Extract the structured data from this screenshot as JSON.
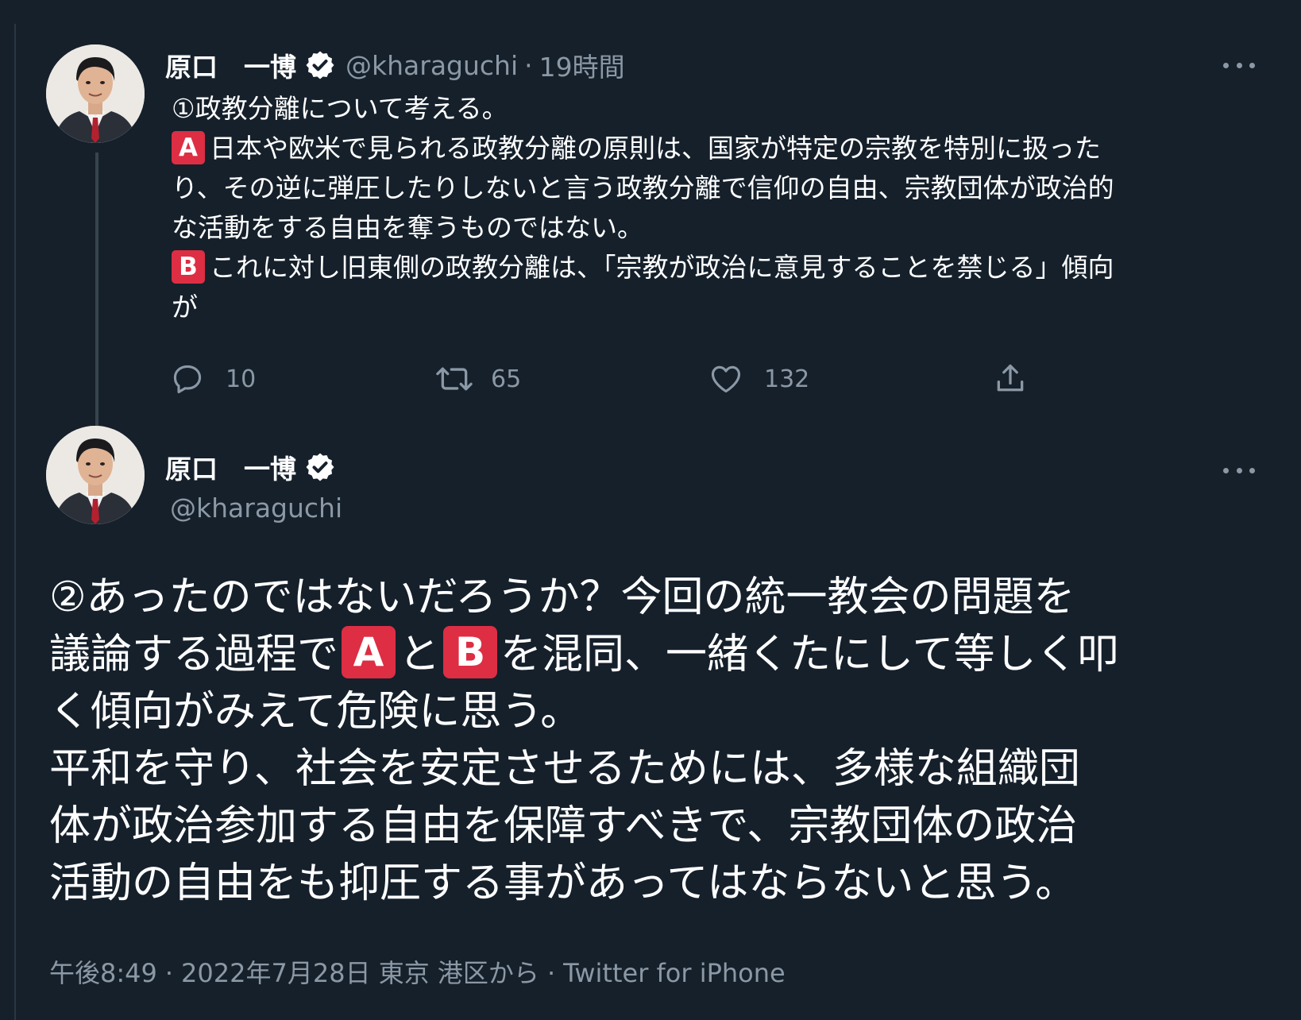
{
  "tweet1": {
    "display_name": "原口　一博",
    "handle": "@kharaguchi",
    "separator": "·",
    "time_ago": "19時間",
    "lines": [
      {
        "badge": "",
        "text": "①政教分離について考える。"
      },
      {
        "badge": "A",
        "text": "日本や欧米で見られる政教分離の原則は、国家が特定の宗教を特別に扱った"
      },
      {
        "badge": "",
        "text": "り、その逆に弾圧したりしないと言う政教分離で信仰の自由、宗教団体が政治的"
      },
      {
        "badge": "",
        "text": "な活動をする自由を奪うものではない。"
      },
      {
        "badge": "B",
        "text": "これに対し旧東側の政教分離は、「宗教が政治に意見することを禁じる」傾向"
      },
      {
        "badge": "",
        "text": "が"
      }
    ],
    "actions": {
      "reply_count": "10",
      "retweet_count": "65",
      "like_count": "132"
    }
  },
  "tweet2": {
    "display_name": "原口　一博",
    "handle": "@kharaguchi",
    "line1": "②あったのではないだろうか？今回の統一教会の問題を",
    "line2_pre": "議論する過程で",
    "badge_a": "A",
    "line2_mid": "と",
    "badge_b": "B",
    "line2_post": "を混同、一緒くたにして等しく叩",
    "line3": "く傾向がみえて危険に思う。",
    "line4": "平和を守り、社会を安定させるためには、多様な組織団",
    "line5": "体が政治参加する自由を保障すべきで、宗教団体の政治",
    "line6": "活動の自由をも抑圧する事があってはならないと思う。",
    "meta": {
      "time": "午後8:49",
      "date": "2022年7月28日",
      "location": "東京 港区から",
      "source": "Twitter for iPhone",
      "sep": "·"
    }
  },
  "colors": {
    "background": "#15202b",
    "text_secondary": "#8b98a5",
    "badge_red": "#dd2e44",
    "thread_line": "#38444d"
  }
}
